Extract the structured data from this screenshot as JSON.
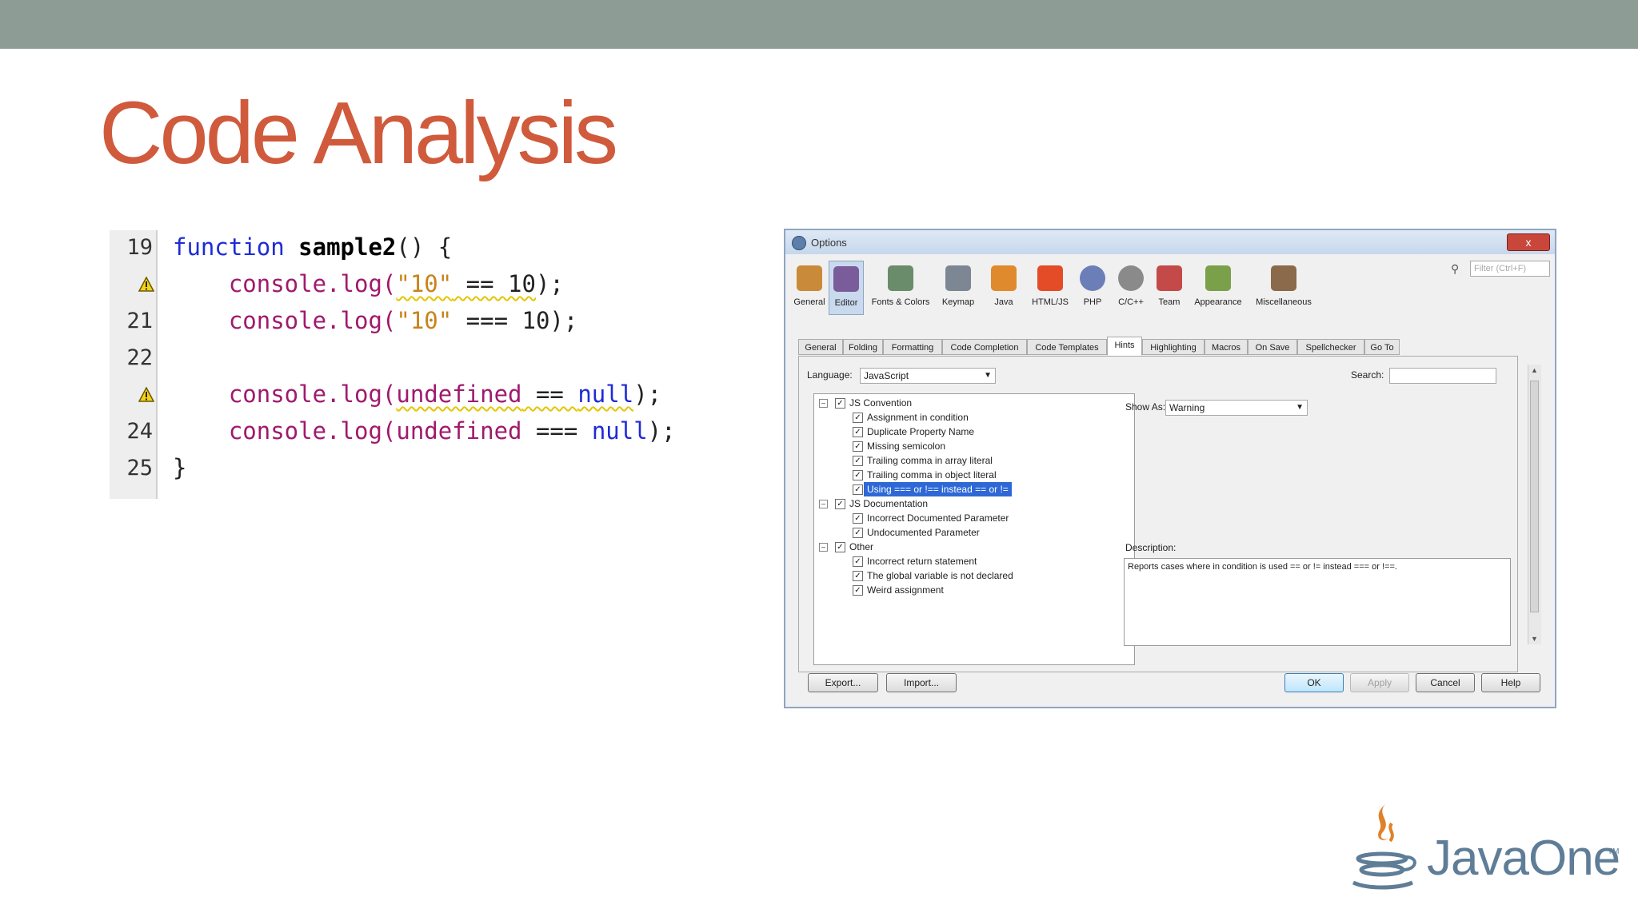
{
  "slide": {
    "title": "Code Analysis"
  },
  "code": {
    "lines": [
      {
        "num": "19",
        "warn": false
      },
      {
        "num": "",
        "warn": true
      },
      {
        "num": "21",
        "warn": false
      },
      {
        "num": "22",
        "warn": false
      },
      {
        "num": "",
        "warn": true
      },
      {
        "num": "24",
        "warn": false
      },
      {
        "num": "25",
        "warn": false
      }
    ],
    "tokens": {
      "kw_function": "function",
      "fn_name": "sample2",
      "open_sig": "() {",
      "console_log": "console.log(",
      "str10": "\"10\"",
      "eq2_10": " == 10",
      "eq3_10": " === 10",
      "close": ");",
      "undef": "undefined",
      "eq2": " == ",
      "eq3": " === ",
      "nul": "null",
      "close_brace": "}"
    }
  },
  "dialog": {
    "title": "Options",
    "close": "x",
    "filter_placeholder": "Filter (Ctrl+F)",
    "categories": [
      {
        "label": "General",
        "color": "#c98b3a"
      },
      {
        "label": "Editor",
        "color": "#7a5c9a"
      },
      {
        "label": "Fonts & Colors",
        "color": "#6a8c6a"
      },
      {
        "label": "Keymap",
        "color": "#7d8793"
      },
      {
        "label": "Java",
        "color": "#e08a2e"
      },
      {
        "label": "HTML/JS",
        "color": "#e34c26"
      },
      {
        "label": "PHP",
        "color": "#6c7eb7"
      },
      {
        "label": "C/C++",
        "color": "#8a8a8a"
      },
      {
        "label": "Team",
        "color": "#c44a4a"
      },
      {
        "label": "Appearance",
        "color": "#7aa04a"
      },
      {
        "label": "Miscellaneous",
        "color": "#8a6a4a"
      }
    ],
    "tabs": [
      "General",
      "Folding",
      "Formatting",
      "Code Completion",
      "Code Templates",
      "Hints",
      "Highlighting",
      "Macros",
      "On Save",
      "Spellchecker",
      "Go To"
    ],
    "language_label": "Language:",
    "language_value": "JavaScript",
    "search_label": "Search:",
    "show_as_label": "Show As:",
    "show_as_value": "Warning",
    "description_label": "Description:",
    "description_text": "Reports cases where in condition is used == or != instead === or !==.",
    "tree": [
      {
        "label": "JS Convention",
        "level": 0
      },
      {
        "label": "Assignment in condition",
        "level": 1
      },
      {
        "label": "Duplicate Property Name",
        "level": 1
      },
      {
        "label": "Missing semicolon",
        "level": 1
      },
      {
        "label": "Trailing comma in array literal",
        "level": 1
      },
      {
        "label": "Trailing comma in object literal",
        "level": 1
      },
      {
        "label": "Using === or !== instead == or !=",
        "level": 1
      },
      {
        "label": "JS Documentation",
        "level": 0
      },
      {
        "label": "Incorrect Documented Parameter",
        "level": 1
      },
      {
        "label": "Undocumented Parameter",
        "level": 1
      },
      {
        "label": "Other",
        "level": 0
      },
      {
        "label": "Incorrect return statement",
        "level": 1
      },
      {
        "label": "The global variable is not declared",
        "level": 1
      },
      {
        "label": "Weird assignment",
        "level": 1
      }
    ],
    "buttons": {
      "export": "Export...",
      "import": "Import...",
      "ok": "OK",
      "apply": "Apply",
      "cancel": "Cancel",
      "help": "Help"
    }
  },
  "logo": {
    "text": "JavaOne",
    "tm": "TM"
  }
}
